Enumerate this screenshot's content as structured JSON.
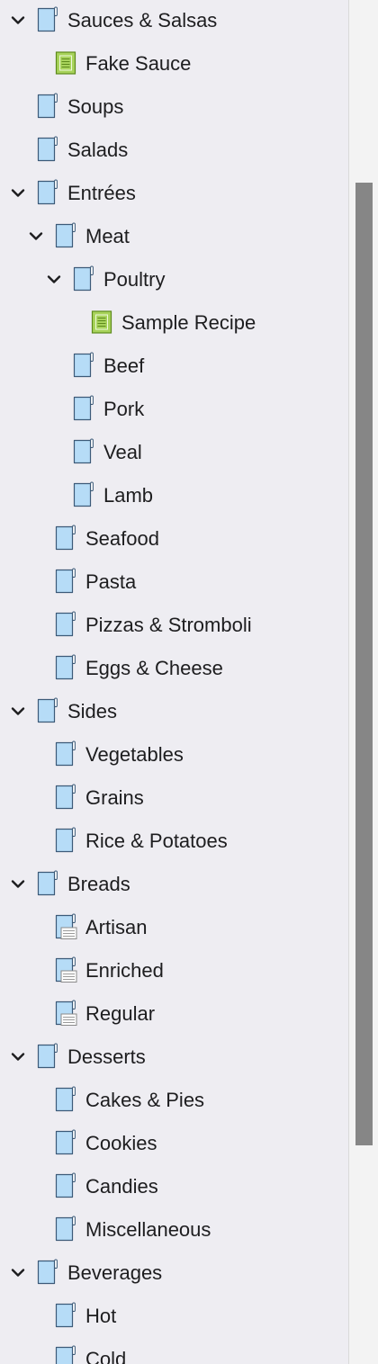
{
  "colors": {
    "folder_fill": "#b6dcf7",
    "folder_stroke": "#3c5a78",
    "text_doc_fill": "#a8d35b",
    "text_doc_stroke": "#5d8a1c",
    "chevron": "#1d1d1f",
    "scrollbar_thumb": "#868686"
  },
  "binder": {
    "items": [
      {
        "label": "Sauces & Salsas",
        "level": 0,
        "icon": "folder-icon",
        "expanded": true
      },
      {
        "label": "Fake Sauce",
        "level": 1,
        "icon": "text-document-icon"
      },
      {
        "label": "Soups",
        "level": 0,
        "icon": "folder-icon"
      },
      {
        "label": "Salads",
        "level": 0,
        "icon": "folder-icon"
      },
      {
        "label": "Entrées",
        "level": 0,
        "icon": "folder-icon",
        "expanded": true
      },
      {
        "label": "Meat",
        "level": 1,
        "icon": "folder-icon",
        "expanded": true
      },
      {
        "label": "Poultry",
        "level": 2,
        "icon": "folder-icon",
        "expanded": true
      },
      {
        "label": "Sample Recipe",
        "level": 3,
        "icon": "text-document-icon"
      },
      {
        "label": "Beef",
        "level": 2,
        "icon": "folder-icon"
      },
      {
        "label": "Pork",
        "level": 2,
        "icon": "folder-icon"
      },
      {
        "label": "Veal",
        "level": 2,
        "icon": "folder-icon"
      },
      {
        "label": "Lamb",
        "level": 2,
        "icon": "folder-icon"
      },
      {
        "label": "Seafood",
        "level": 1,
        "icon": "folder-icon"
      },
      {
        "label": "Pasta",
        "level": 1,
        "icon": "folder-icon"
      },
      {
        "label": "Pizzas & Stromboli",
        "level": 1,
        "icon": "folder-icon"
      },
      {
        "label": "Eggs & Cheese",
        "level": 1,
        "icon": "folder-icon"
      },
      {
        "label": "Sides",
        "level": 0,
        "icon": "folder-icon",
        "expanded": true
      },
      {
        "label": "Vegetables",
        "level": 1,
        "icon": "folder-icon"
      },
      {
        "label": "Grains",
        "level": 1,
        "icon": "folder-icon"
      },
      {
        "label": "Rice & Potatoes",
        "level": 1,
        "icon": "folder-icon"
      },
      {
        "label": "Breads",
        "level": 0,
        "icon": "folder-icon",
        "expanded": true
      },
      {
        "label": "Artisan",
        "level": 1,
        "icon": "folder-with-text-icon"
      },
      {
        "label": "Enriched",
        "level": 1,
        "icon": "folder-with-text-icon"
      },
      {
        "label": "Regular",
        "level": 1,
        "icon": "folder-with-text-icon"
      },
      {
        "label": "Desserts",
        "level": 0,
        "icon": "folder-icon",
        "expanded": true
      },
      {
        "label": "Cakes & Pies",
        "level": 1,
        "icon": "folder-icon"
      },
      {
        "label": "Cookies",
        "level": 1,
        "icon": "folder-icon"
      },
      {
        "label": "Candies",
        "level": 1,
        "icon": "folder-icon"
      },
      {
        "label": "Miscellaneous",
        "level": 1,
        "icon": "folder-icon"
      },
      {
        "label": "Beverages",
        "level": 0,
        "icon": "folder-icon",
        "expanded": true
      },
      {
        "label": "Hot",
        "level": 1,
        "icon": "folder-icon"
      },
      {
        "label": "Cold",
        "level": 1,
        "icon": "folder-icon"
      }
    ]
  }
}
